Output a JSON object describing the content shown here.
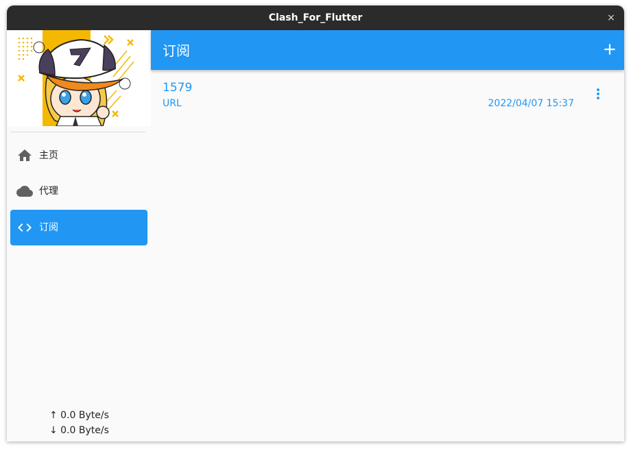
{
  "window": {
    "title": "Clash_For_Flutter",
    "close_glyph": "×"
  },
  "sidebar": {
    "items": [
      {
        "label": "主页",
        "icon": "home-icon",
        "active": false
      },
      {
        "label": "代理",
        "icon": "cloud-icon",
        "active": false
      },
      {
        "label": "订阅",
        "icon": "code-icon",
        "active": true
      }
    ],
    "traffic": {
      "upload": "↑ 0.0 Byte/s",
      "download": "↓ 0.0 Byte/s"
    }
  },
  "main": {
    "title": "订阅",
    "add_icon": "plus-icon",
    "subscriptions": [
      {
        "name": "1579",
        "type": "URL",
        "updated": "2022/04/07 15:37"
      }
    ]
  },
  "colors": {
    "accent": "#2196f3",
    "titlebar": "#2b2b2b",
    "icon_gray": "#616161",
    "background": "#fafafa"
  }
}
